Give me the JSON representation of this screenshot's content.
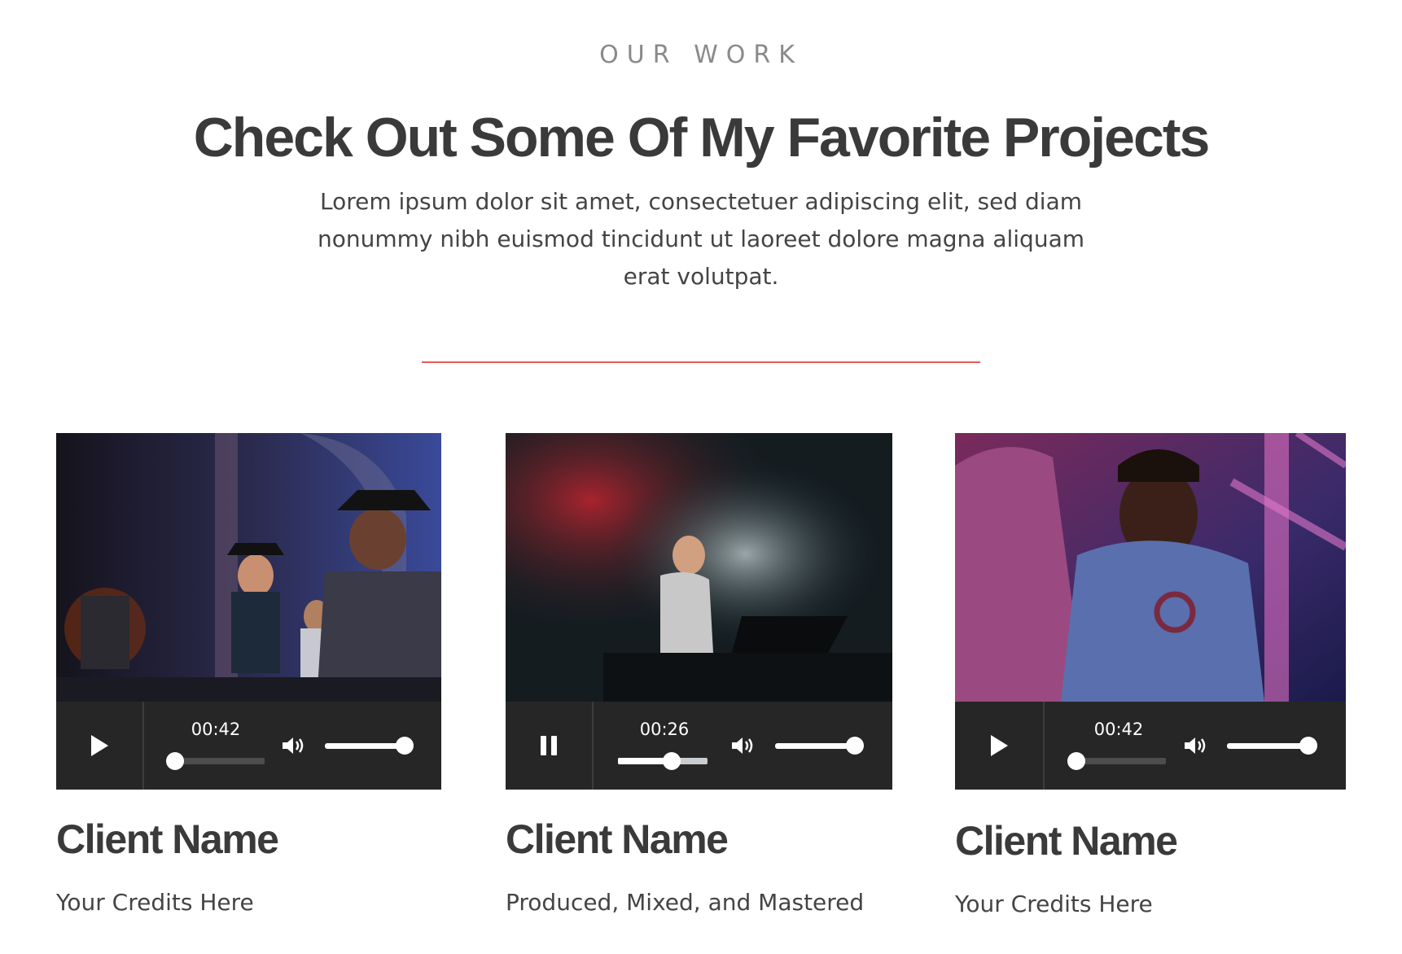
{
  "section": {
    "eyebrow": "OUR WORK",
    "title": "Check Out Some Of My Favorite Projects",
    "intro": "Lorem ipsum dolor sit amet, consectetuer adipiscing elit, sed diam nonummy nibh euismod tincidunt ut laoreet dolore magna aliquam erat volutpat.",
    "divider_color": "#e85a56"
  },
  "projects": [
    {
      "client_name": "Client Name",
      "credits": "Your Credits Here",
      "player": {
        "state": "paused",
        "control_icon": "play-icon",
        "time": "00:42",
        "progress": 0.0,
        "volume": 1.0
      }
    },
    {
      "client_name": "Client Name",
      "credits": "Produced, Mixed, and Mastered",
      "player": {
        "state": "playing",
        "control_icon": "pause-icon",
        "time": "00:26",
        "progress": 0.6,
        "volume": 1.0
      }
    },
    {
      "client_name": "Client Name",
      "credits": "Your Credits Here",
      "player": {
        "state": "paused",
        "control_icon": "play-icon",
        "time": "00:42",
        "progress": 0.0,
        "volume": 1.0
      }
    }
  ]
}
